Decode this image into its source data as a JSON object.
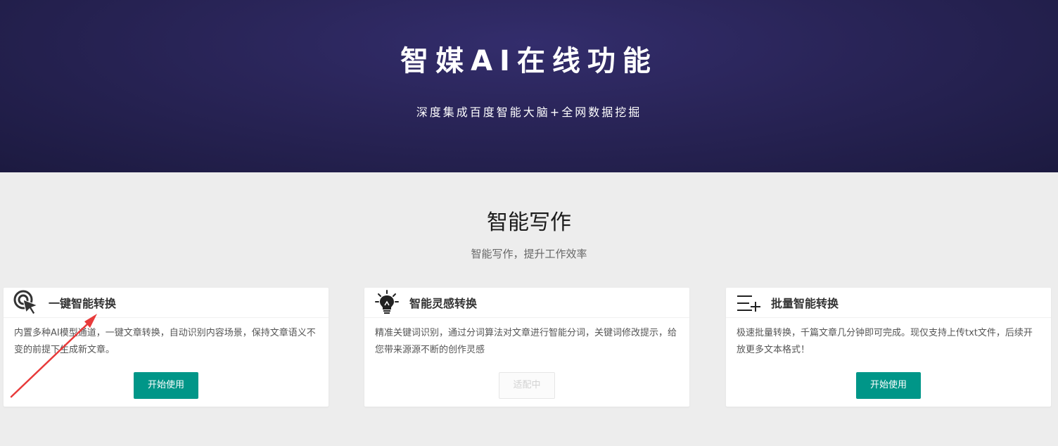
{
  "hero": {
    "title": "智媒AI在线功能",
    "subtitle": "深度集成百度智能大脑+全网数据挖掘"
  },
  "section": {
    "title": "智能写作",
    "subtitle": "智能写作，提升工作效率"
  },
  "cards": [
    {
      "icon": "cursor-target-icon",
      "title": "一键智能转换",
      "desc": "内置多种AI模型通道，一键文章转换，自动识别内容场景，保持文章语义不变的前提下生成新文章。",
      "button": "开始使用",
      "button_state": "enabled"
    },
    {
      "icon": "lightbulb-icon",
      "title": "智能灵感转换",
      "desc": "精准关键词识别，通过分词算法对文章进行智能分词，关键词修改提示，给您带来源源不断的创作灵感",
      "button": "适配中",
      "button_state": "disabled"
    },
    {
      "icon": "list-add-icon",
      "title": "批量智能转换",
      "desc": "极速批量转换，千篇文章几分钟即可完成。现仅支持上传txt文件，后续开放更多文本格式！",
      "button": "开始使用",
      "button_state": "enabled"
    }
  ],
  "colors": {
    "hero_bg": "#2a2559",
    "primary": "#009688",
    "annotation_arrow": "#e83a3a"
  }
}
